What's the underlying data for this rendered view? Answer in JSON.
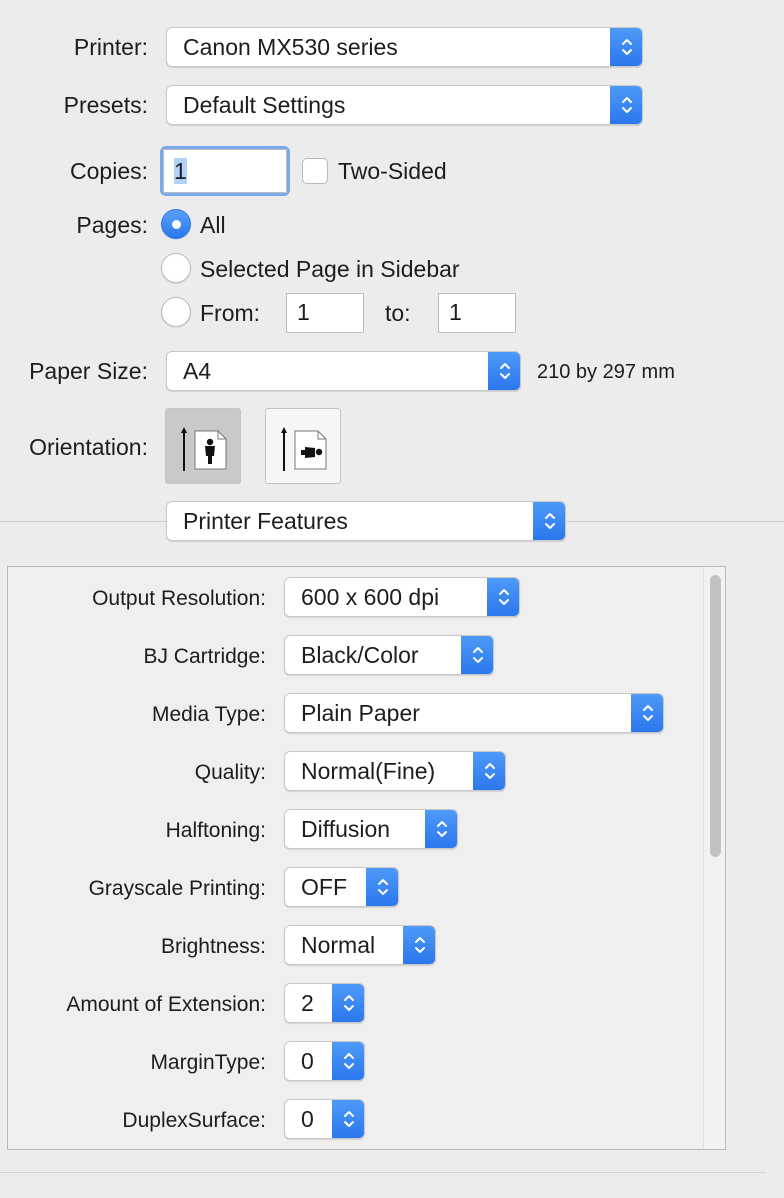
{
  "printer": {
    "label": "Printer:",
    "value": "Canon MX530 series"
  },
  "presets": {
    "label": "Presets:",
    "value": "Default Settings"
  },
  "copies": {
    "label": "Copies:",
    "value": "1",
    "two_sided_label": "Two-Sided"
  },
  "pages": {
    "label": "Pages:",
    "options": [
      "All",
      "Selected Page in Sidebar",
      "From:"
    ],
    "selected": "All",
    "from_value": "1",
    "to_label": "to:",
    "to_value": "1"
  },
  "paper_size": {
    "label": "Paper Size:",
    "value": "A4",
    "dimensions": "210 by 297 mm"
  },
  "orientation": {
    "label": "Orientation:",
    "options": [
      "portrait-icon",
      "landscape-icon"
    ],
    "selected": "portrait"
  },
  "section": {
    "value": "Printer Features"
  },
  "features": [
    {
      "label": "Output Resolution:",
      "value": "600 x 600 dpi"
    },
    {
      "label": "BJ Cartridge:",
      "value": "Black/Color"
    },
    {
      "label": "Media Type:",
      "value": "Plain Paper"
    },
    {
      "label": "Quality:",
      "value": "Normal(Fine)"
    },
    {
      "label": "Halftoning:",
      "value": "Diffusion"
    },
    {
      "label": "Grayscale Printing:",
      "value": "OFF"
    },
    {
      "label": "Brightness:",
      "value": "Normal"
    },
    {
      "label": "Amount of Extension:",
      "value": "2"
    },
    {
      "label": "MarginType:",
      "value": "0"
    },
    {
      "label": "DuplexSurface:",
      "value": "0"
    }
  ],
  "colors": {
    "accent": "#2a76ee",
    "background": "#ececec"
  }
}
